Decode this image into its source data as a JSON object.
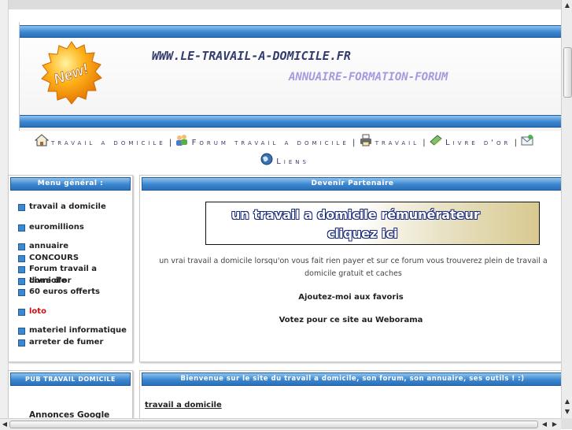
{
  "header": {
    "site_url": "WWW.LE-TRAVAIL-A-DOMICILE.FR",
    "subtitle": "ANNUAIRE-FORMATION-FORUM",
    "badge_text": "New!"
  },
  "nav": {
    "items": [
      {
        "label": "travail a domicile",
        "icon": "home-icon"
      },
      {
        "label": "Forum travail a domicile",
        "icon": "users-icon"
      },
      {
        "label": "travail",
        "icon": "printer-icon"
      },
      {
        "label": "Livre d'or",
        "icon": "book-icon"
      },
      {
        "label": "Liens",
        "icon": "globe-icon"
      }
    ],
    "separator": "|"
  },
  "menu": {
    "title": "Menu général :",
    "items": [
      {
        "label": "travail a domicile"
      },
      {
        "label": "euromillions"
      },
      {
        "label": "annuaire"
      },
      {
        "label": "CONCOURS"
      },
      {
        "label": "Forum travail a domicile"
      },
      {
        "label": "Livre d'or"
      },
      {
        "label": "60 euros offerts"
      },
      {
        "label": "loto"
      },
      {
        "label": "materiel informatique"
      },
      {
        "label": "arreter de fumer"
      }
    ]
  },
  "partner": {
    "title": "Devenir Partenaire",
    "banner_line1": "un travail a domicile rémunérateur",
    "banner_line2": "cliquez ici",
    "intro": "un vrai travail a domicile lorsqu'on vous fait rien payer et sur ce forum vous trouverez plein de travail a domicile gratuit et caches",
    "favorites": "Ajoutez-moi aux favoris",
    "vote": "Votez pour ce site au Weborama"
  },
  "pub": {
    "title": "PUB TRAVAIL DOMICILE",
    "ads_label": "Annonces Google"
  },
  "welcome": {
    "title": "Bienvenue sur le site du travail a domicile, son forum, son annuaire, ses outils ! :)",
    "link": "travail a domicile"
  },
  "colors": {
    "accent_blue": "#3b86d0",
    "nav_text": "#3b3b6b",
    "loto_red": "#d01010"
  }
}
